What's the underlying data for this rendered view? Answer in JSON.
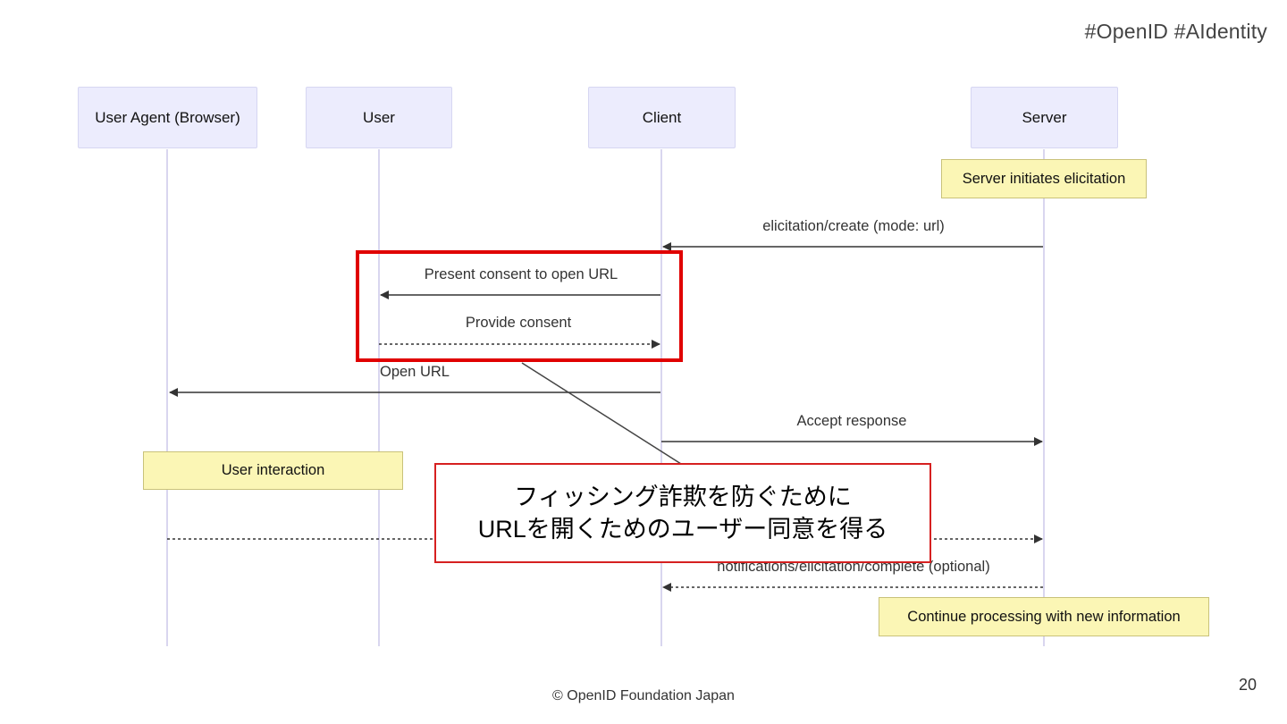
{
  "hashtags": "#OpenID  #AIdentity",
  "participants": {
    "browser": "User Agent (Browser)",
    "user": "User",
    "client": "Client",
    "server": "Server"
  },
  "notes": {
    "server_init": "Server initiates elicitation",
    "user_interaction": "User interaction",
    "continue": "Continue processing with new information"
  },
  "messages": {
    "create": "elicitation/create (mode: url)",
    "present": "Present consent to open URL",
    "provide": "Provide consent",
    "open_url": "Open URL",
    "accept": "Accept response",
    "complete": "notifications/elicitation/complete (optional)"
  },
  "callout": {
    "line1": "フィッシング詐欺を防ぐために",
    "line2": "URLを開くためのユーザー同意を得る"
  },
  "footer": "© OpenID Foundation Japan",
  "page_number": "20"
}
